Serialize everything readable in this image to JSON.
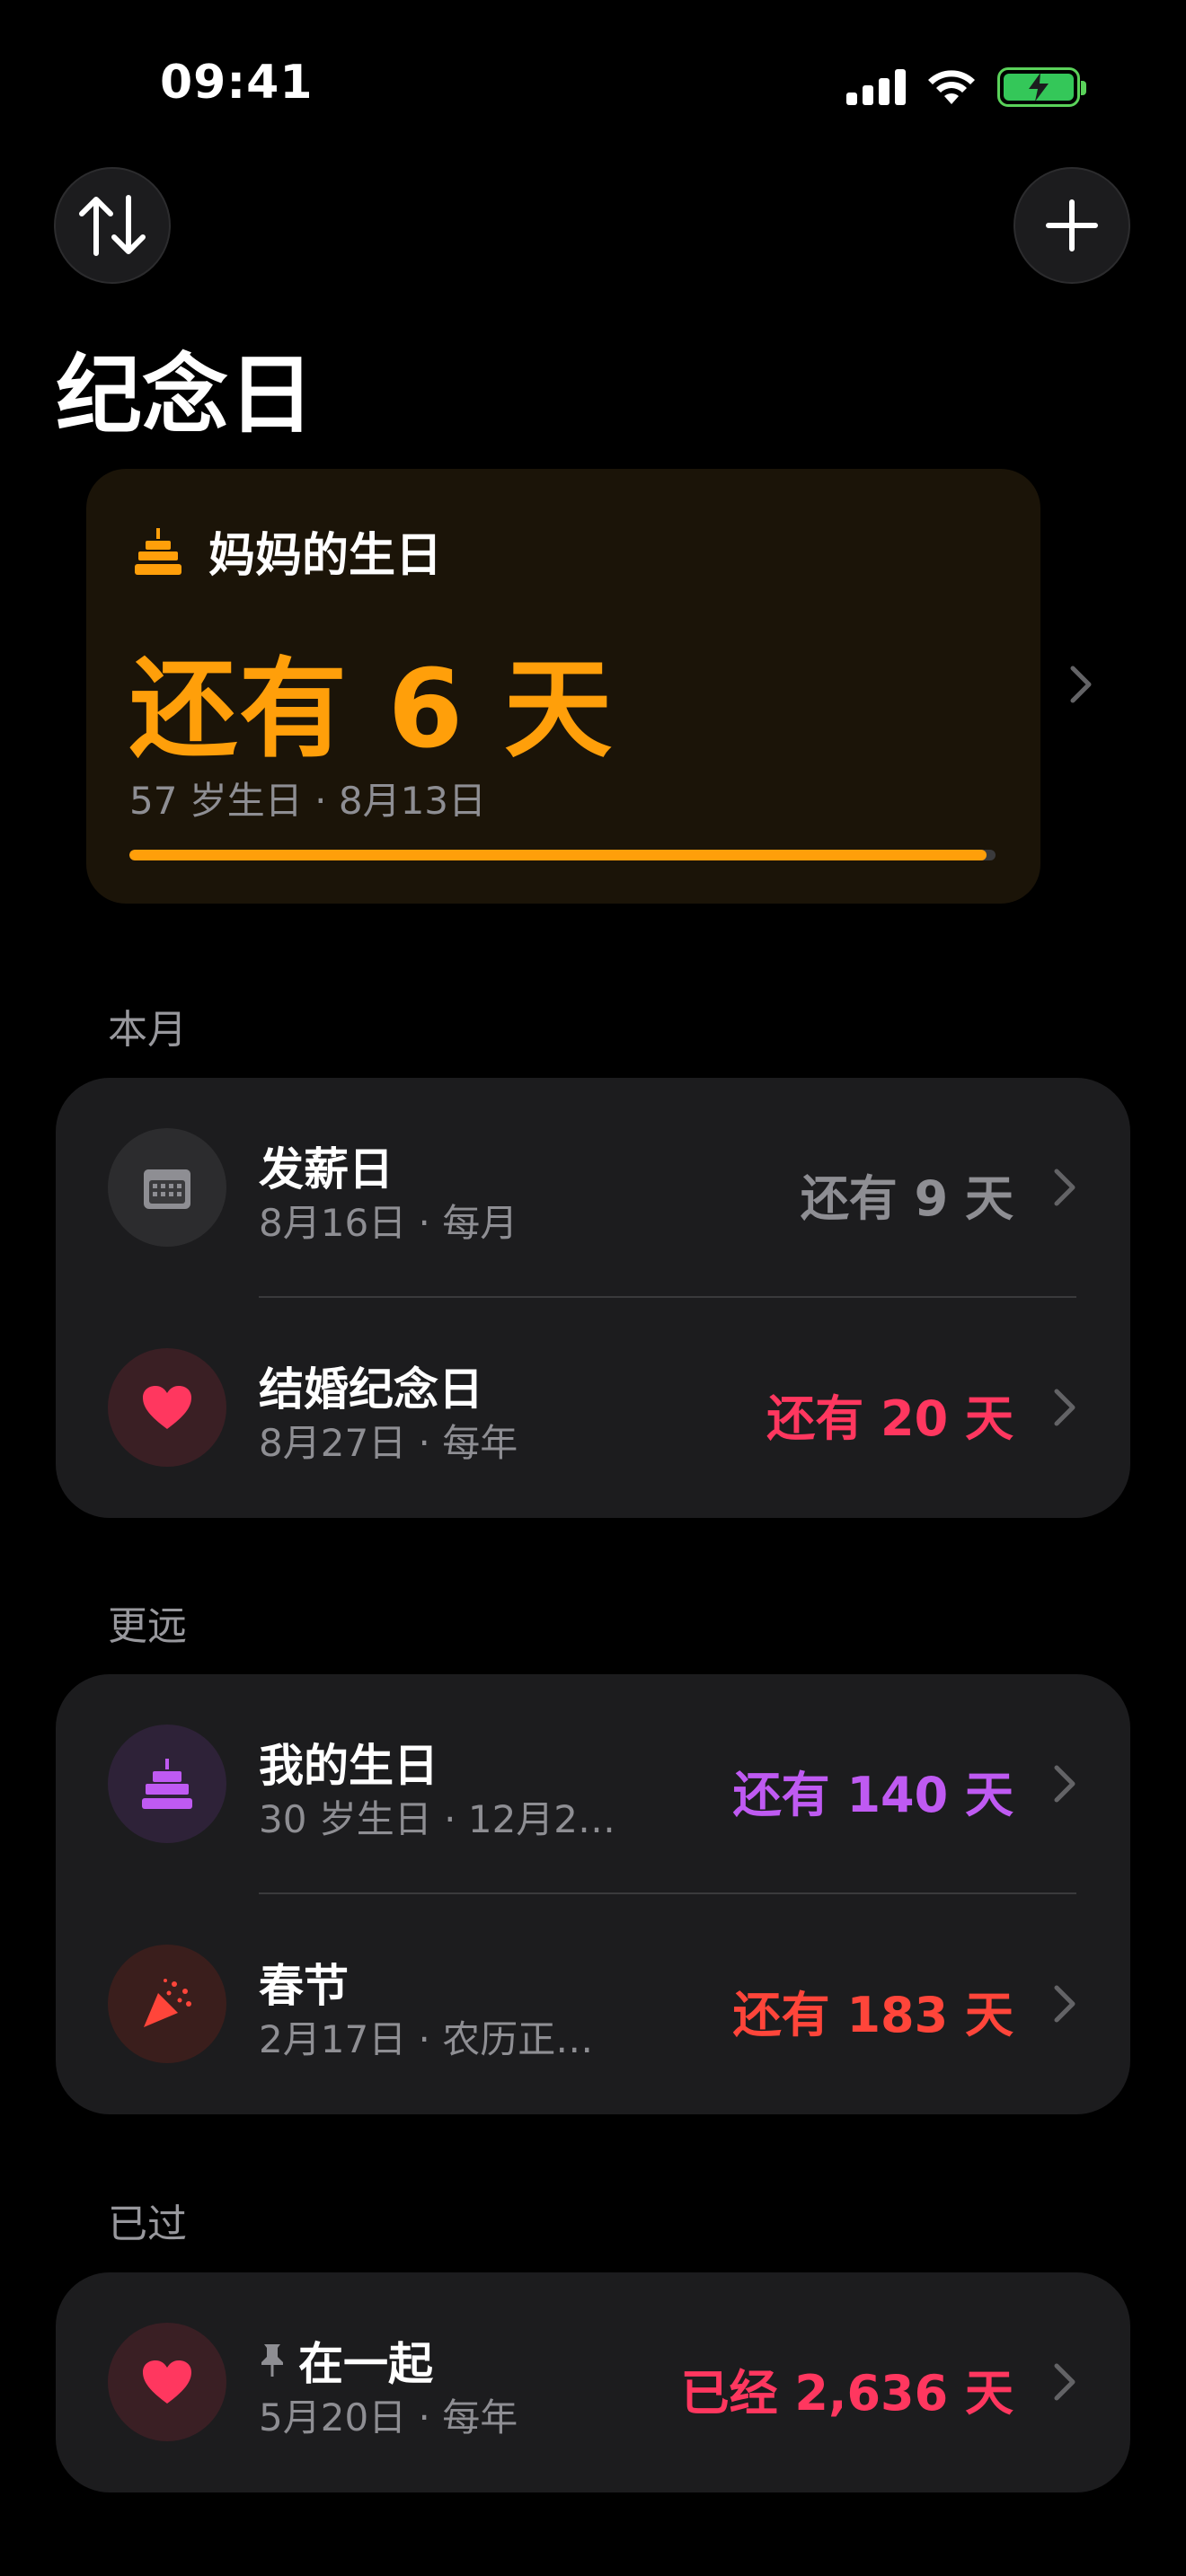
{
  "status": {
    "time": "09:41"
  },
  "header": {
    "title": "纪念日"
  },
  "featured": {
    "name": "妈妈的生日",
    "countdown": "还有 6 天",
    "subtitle": "57 岁生日 · 8月13日",
    "progress": 0.99,
    "accent": "#ff9f0a"
  },
  "sections": [
    {
      "label": "本月",
      "items": [
        {
          "title": "发薪日",
          "meta": "8月16日 · 每月",
          "count": "还有 9 天",
          "icon": "calendar-icon",
          "color": "#8e8e93",
          "iconBg": "#2c2c2e"
        },
        {
          "title": "结婚纪念日",
          "meta": "8月27日 · 每年",
          "count": "还有 20 天",
          "icon": "heart-icon",
          "color": "#ff375f",
          "iconBg": "#3a1f24"
        }
      ]
    },
    {
      "label": "更远",
      "items": [
        {
          "title": "我的生日",
          "meta": "30 岁生日 · 12月2…",
          "count": "还有 140 天",
          "icon": "cake-icon",
          "color": "#bf5af2",
          "iconBg": "#2e2238"
        },
        {
          "title": "春节",
          "meta": "2月17日 · 农历正…",
          "count": "还有 183 天",
          "icon": "party-popper-icon",
          "color": "#ff453a",
          "iconBg": "#3a1e1c"
        }
      ]
    },
    {
      "label": "已过",
      "items": [
        {
          "title": "在一起",
          "meta": "5月20日 · 每年",
          "count": "已经 2,636 天",
          "icon": "heart-icon",
          "color": "#ff375f",
          "iconBg": "#3a1f24",
          "pinned": true
        }
      ]
    }
  ]
}
